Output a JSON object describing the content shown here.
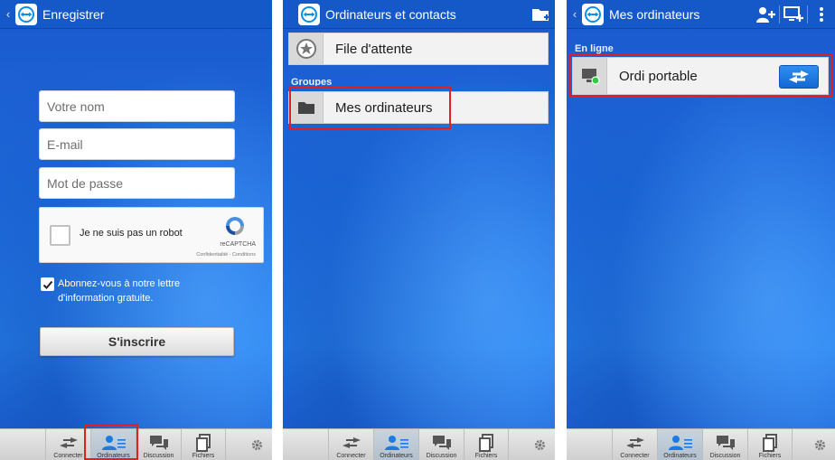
{
  "colors": {
    "accent_blue": "#1559c8",
    "highlight_red": "#e0201e",
    "online_green": "#2ecc40"
  },
  "screen1": {
    "title": "Enregistrer",
    "name_placeholder": "Votre nom",
    "email_placeholder": "E-mail",
    "password_placeholder": "Mot de passe",
    "captcha_label": "Je ne suis pas un robot",
    "captcha_brand": "reCAPTCHA",
    "captcha_links": "Confidentialité - Conditions",
    "newsletter_checked": true,
    "newsletter_label": "Abonnez-vous à notre lettre d'information gratuite.",
    "signup_label": "S'inscrire"
  },
  "screen2": {
    "title": "Ordinateurs et contacts",
    "queue_label": "File d'attente",
    "groups_header": "Groupes",
    "group_label": "Mes ordinateurs"
  },
  "screen3": {
    "title": "Mes ordinateurs",
    "online_header": "En ligne",
    "computer_label": "Ordi portable"
  },
  "nav": {
    "connect": "Connecter",
    "computers": "Ordinateurs",
    "chat": "Discussion",
    "files": "Fichiers"
  },
  "icons": [
    "back-chevron-icon",
    "teamviewer-logo-icon",
    "star-icon",
    "folder-icon",
    "add-folder-icon",
    "add-contact-icon",
    "add-computer-icon",
    "overflow-menu-icon",
    "monitor-icon",
    "connect-arrows-icon",
    "arrows-icon",
    "contacts-icon",
    "chat-icon",
    "files-icon",
    "gear-icon"
  ]
}
